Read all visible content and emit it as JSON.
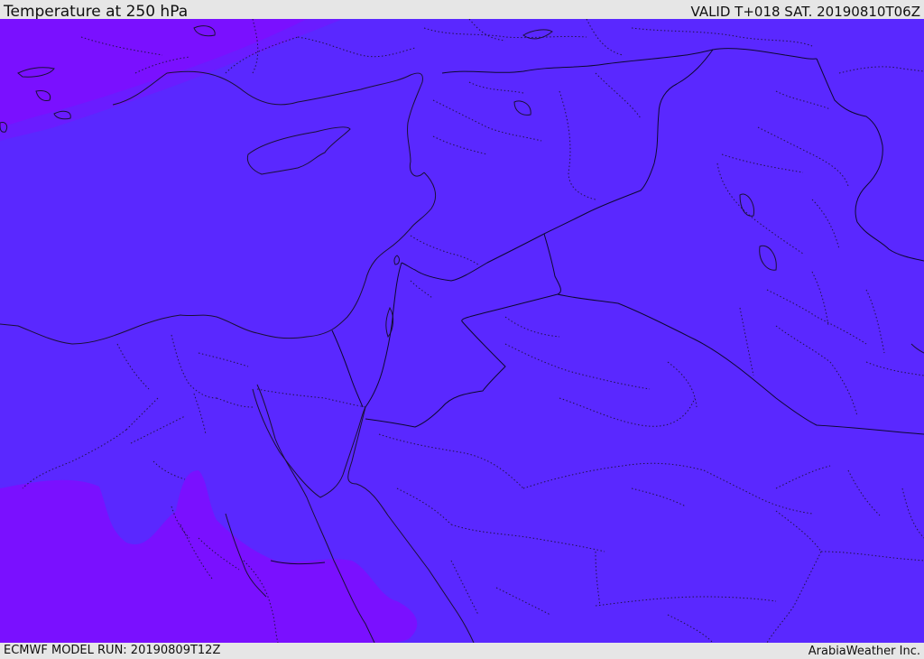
{
  "header": {
    "title": "Temperature at 250 hPa",
    "valid": "VALID T+018 SAT. 20190810T06Z"
  },
  "footer": {
    "model_run": "ECMWF MODEL RUN: 20190809T12Z",
    "credit": "ArabiaWeather Inc."
  },
  "map": {
    "colors": {
      "main_field": "#5a28ff",
      "cold_field": "#7a10ff",
      "cold_edge": "#6a1cff",
      "coast": "#1a1035",
      "border": "#0d0830"
    }
  }
}
